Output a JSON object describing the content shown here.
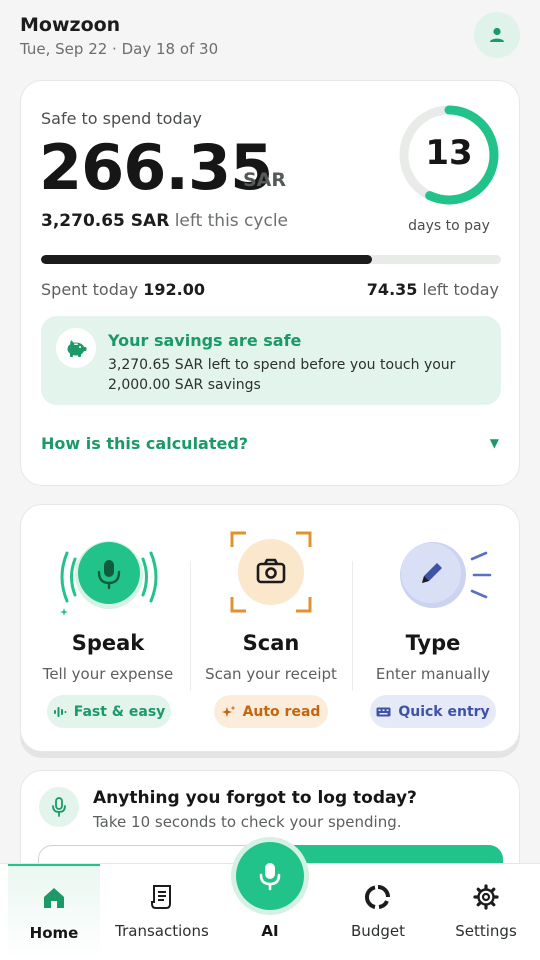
{
  "header": {
    "title": "Mowzoon",
    "subtitle": "Tue, Sep 22 · Day 18 of 30",
    "avatar_icon": "user-icon"
  },
  "safe": {
    "label": "Safe to spend today",
    "amount": "266.35",
    "currency": "SAR",
    "cycle_amount": "3,270.65 SAR",
    "cycle_suffix": "left this cycle",
    "days_number": "13",
    "days_caption": "days to pay",
    "days_progress_fraction": 0.57,
    "spent_progress_fraction": 0.72,
    "spent_label": "Spent today",
    "spent_value": "192.00",
    "left_value": "74.35",
    "left_label": "left today"
  },
  "savings": {
    "title": "Your savings are safe",
    "text": "3,270.65 SAR left to spend before you touch your 2,000.00 SAR savings",
    "icon": "piggy-bank-icon"
  },
  "how_link": "How is this calculated?",
  "actions": [
    {
      "title": "Speak",
      "subtitle": "Tell your expense",
      "pill": "Fast & easy",
      "icon": "microphone-icon",
      "pill_icon": "waveform-icon"
    },
    {
      "title": "Scan",
      "subtitle": "Scan your receipt",
      "pill": "Auto read",
      "icon": "camera-icon",
      "pill_icon": "sparkle-icon"
    },
    {
      "title": "Type",
      "subtitle": "Enter manually",
      "pill": "Quick entry",
      "icon": "pencil-icon",
      "pill_icon": "keyboard-icon"
    }
  ],
  "forgot": {
    "title": "Anything you forgot to log today?",
    "subtitle": "Take 10 seconds to check your spending."
  },
  "nav": [
    {
      "label": "Home",
      "icon": "home-icon",
      "active": true
    },
    {
      "label": "Transactions",
      "icon": "receipt-icon"
    },
    {
      "label": "AI",
      "icon": "microphone-icon"
    },
    {
      "label": "Budget",
      "icon": "donut-chart-icon"
    },
    {
      "label": "Settings",
      "icon": "gear-icon"
    }
  ],
  "colors": {
    "accent": "#22c38a",
    "accent_dark": "#1b9a68",
    "scan_orange": "#e0922e",
    "type_blue": "#3f53a6"
  }
}
